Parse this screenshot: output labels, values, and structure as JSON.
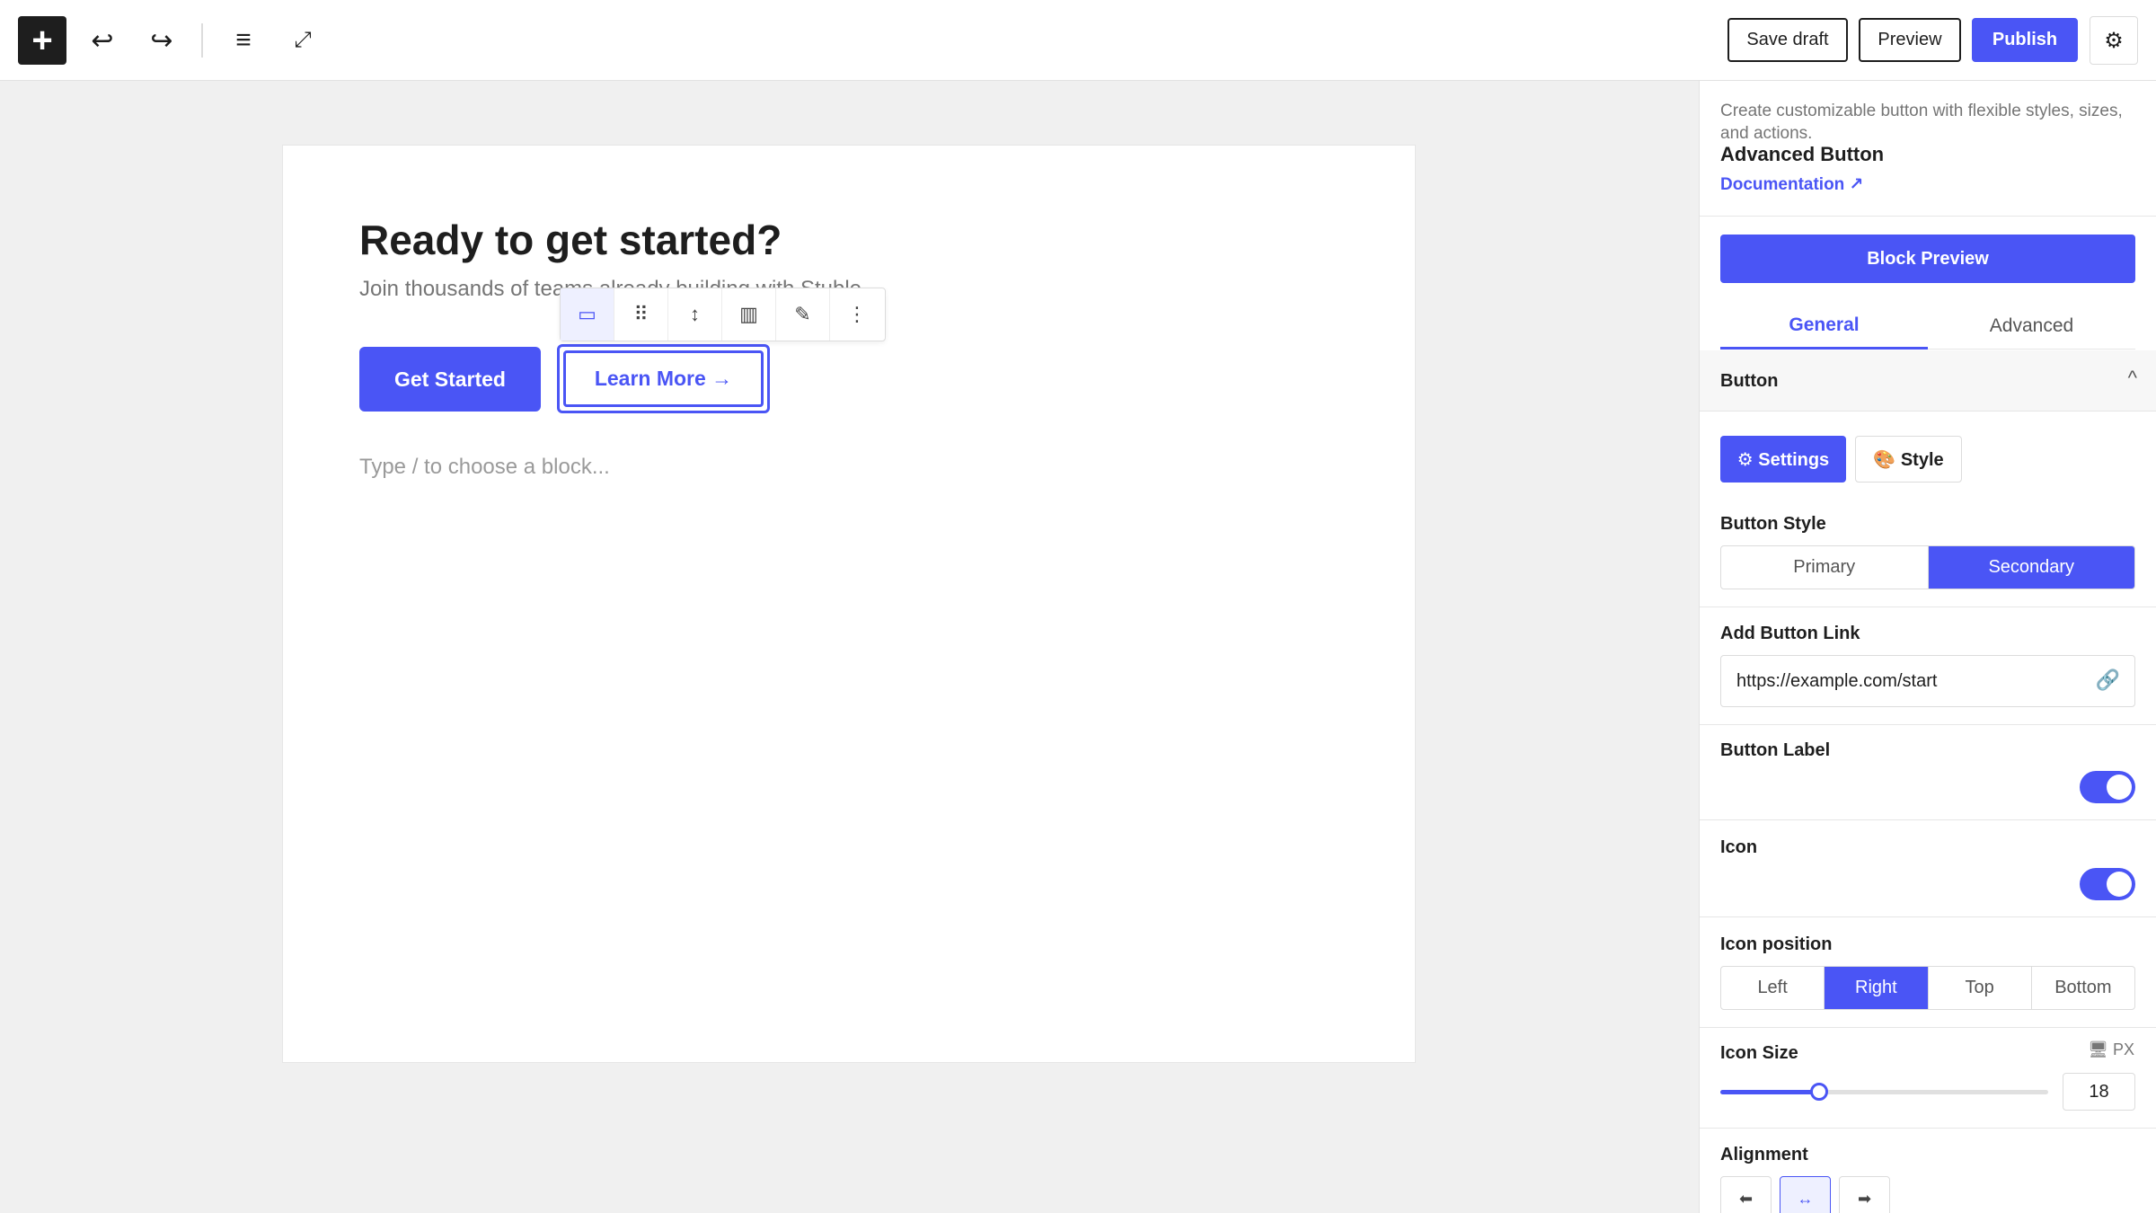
{
  "topbar": {
    "add_icon": "+",
    "undo_icon": "↩",
    "redo_icon": "↪",
    "list_view_icon": "≡",
    "expand_icon": "⤢",
    "save_draft": "Save draft",
    "preview": "Preview",
    "publish": "Publish",
    "settings_icon": "⚙"
  },
  "canvas": {
    "heading": "Ready to get started?",
    "subtext": "Join thousands of teams already building with Stuble",
    "primary_button": "Get Started",
    "secondary_button": "Learn More →",
    "placeholder": "Type / to choose a block..."
  },
  "block_toolbar": {
    "items": [
      {
        "icon": "button-block-icon",
        "glyph": "▭"
      },
      {
        "icon": "drag-handle-icon",
        "glyph": "⠿"
      },
      {
        "icon": "move-up-down-icon",
        "glyph": "↕"
      },
      {
        "icon": "align-icon",
        "glyph": "▥"
      },
      {
        "icon": "pencil-icon",
        "glyph": "✎"
      },
      {
        "icon": "more-options-icon",
        "glyph": "⋮"
      }
    ]
  },
  "sidebar": {
    "description": "Create customizable button with flexible styles, sizes, and actions.",
    "block_title": "Advanced Button",
    "documentation": "Documentation ↗",
    "block_preview": "Block Preview",
    "tabs": [
      "General",
      "Advanced"
    ],
    "panel_title": "Button",
    "chevron": "^",
    "pills": {
      "settings": "⚙ Settings",
      "style": "🎨 Style"
    },
    "button_style": {
      "label": "Button Style",
      "options": [
        "Primary",
        "Secondary"
      ],
      "selected": "Secondary"
    },
    "link": {
      "label": "Add Button Link",
      "value": "https://example.com/start",
      "icon": "🔗"
    },
    "button_label_toggle": {
      "label": "Button Label",
      "on": true
    },
    "icon_toggle": {
      "label": "Icon",
      "on": true
    },
    "icon_position": {
      "label": "Icon position",
      "options": [
        "Left",
        "Right",
        "Top",
        "Bottom"
      ],
      "selected": "Right"
    },
    "icon_size": {
      "label": "Icon Size",
      "device_icon": "🖥",
      "unit": "PX",
      "value": "18",
      "slider_fraction": 0.3
    },
    "alignment": {
      "label": "Alignment",
      "options": [
        "⬅",
        "↔",
        "➡"
      ],
      "selected_index": 1
    }
  },
  "colors": {
    "accent": "#4a55f5",
    "dark": "#1e1e1e",
    "muted": "#757575"
  }
}
